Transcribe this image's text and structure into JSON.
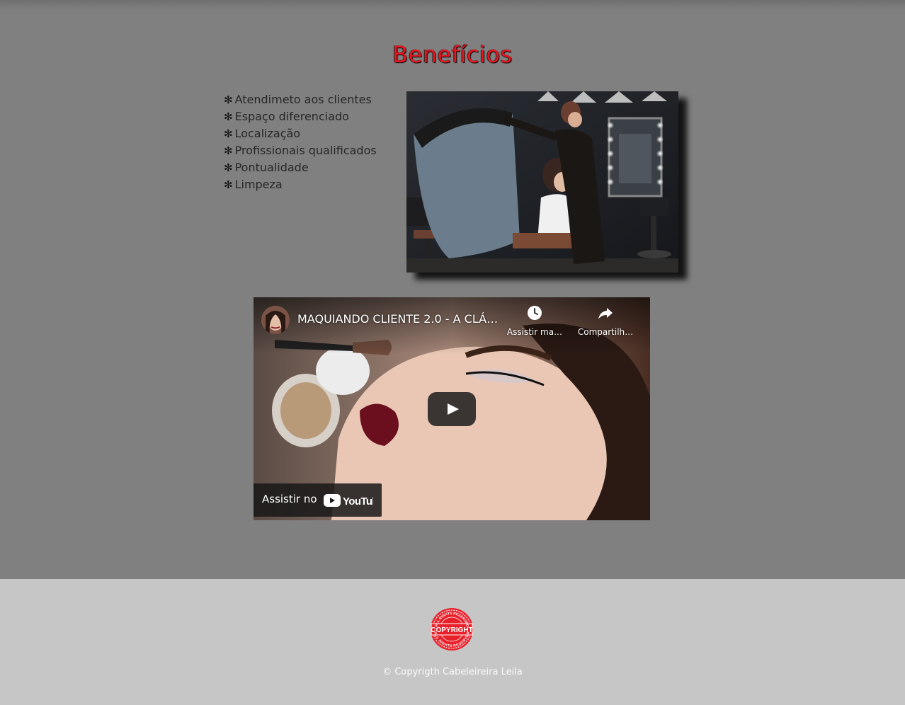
{
  "section": {
    "title": "Benefícios",
    "benefits": [
      {
        "bullet": "✻",
        "label": "Atendimeto aos clientes"
      },
      {
        "bullet": "✻",
        "label": "Espaço diferenciado"
      },
      {
        "bullet": "✻",
        "label": "Localização"
      },
      {
        "bullet": "✻",
        "label": "Profissionais qualificados"
      },
      {
        "bullet": "✻",
        "label": "Pontualidade"
      },
      {
        "bullet": "✻",
        "label": "Limpeza"
      }
    ]
  },
  "video": {
    "title": "MAQUIANDO CLIENTE 2.0 - A CLÁ…",
    "watch_later_label": "Assistir ma…",
    "share_label": "Compartilh…",
    "watch_on_label": "Assistir no",
    "platform": "YouTube"
  },
  "footer": {
    "seal_text_top": "ALL RIGHTS RESERVED",
    "seal_text_center": "COPYRIGHT",
    "seal_text_bottom": "ALL RIGHTS RESERVED",
    "text": "© Copyrigth Cabeleireira Leila"
  },
  "colors": {
    "page_background": "#808080",
    "footer_background": "#c6c6c6",
    "title_color": "#e8141e",
    "seal_color": "#e8202a"
  },
  "icons": [
    "bullet-star-icon",
    "clock-icon",
    "share-icon",
    "play-icon",
    "youtube-logo-icon",
    "copyright-seal-icon"
  ]
}
